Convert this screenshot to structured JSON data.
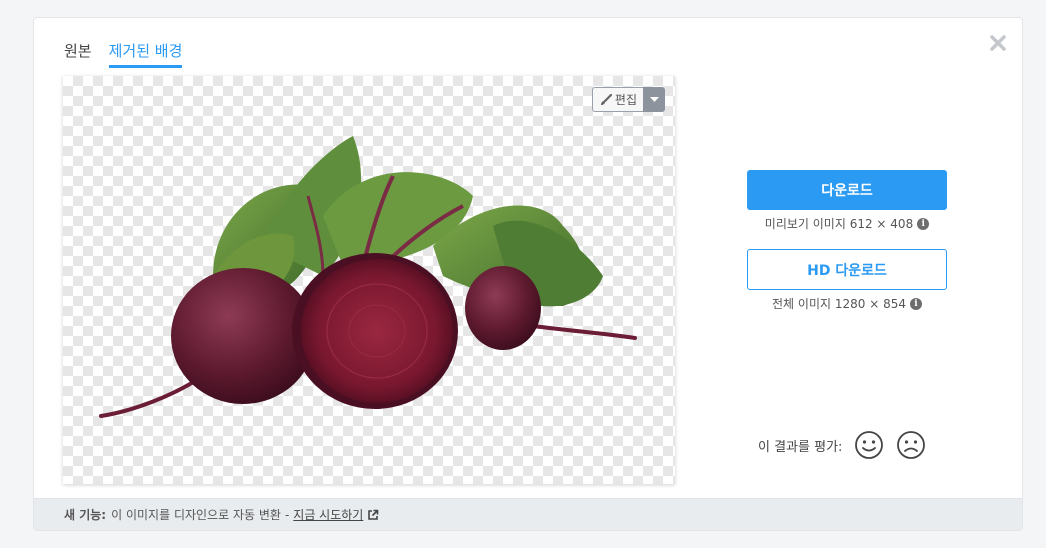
{
  "tabs": [
    {
      "label": "원본",
      "active": false
    },
    {
      "label": "제거된 배경",
      "active": true
    }
  ],
  "editor": {
    "edit_label": "편집"
  },
  "download": {
    "primary_label": "다운로드",
    "preview_info": "미리보기 이미지 612 × 408",
    "hd_label": "HD 다운로드",
    "full_info": "전체 이미지 1280 × 854"
  },
  "rating": {
    "label": "이 결과를 평가:"
  },
  "footer": {
    "badge": "새 기능:",
    "text": "이 이미지를 디자인으로 자동 변환",
    "separator": "-",
    "link": "지금 시도하기"
  },
  "colors": {
    "accent": "#2b9af3",
    "footer_bg": "#e9ecef",
    "beet": "#6a1d34",
    "leaf": "#5d8a3a"
  },
  "icons": [
    "close-icon",
    "brush-icon",
    "caret-down-icon",
    "info-icon",
    "smile-icon",
    "frown-icon",
    "external-link-icon"
  ]
}
